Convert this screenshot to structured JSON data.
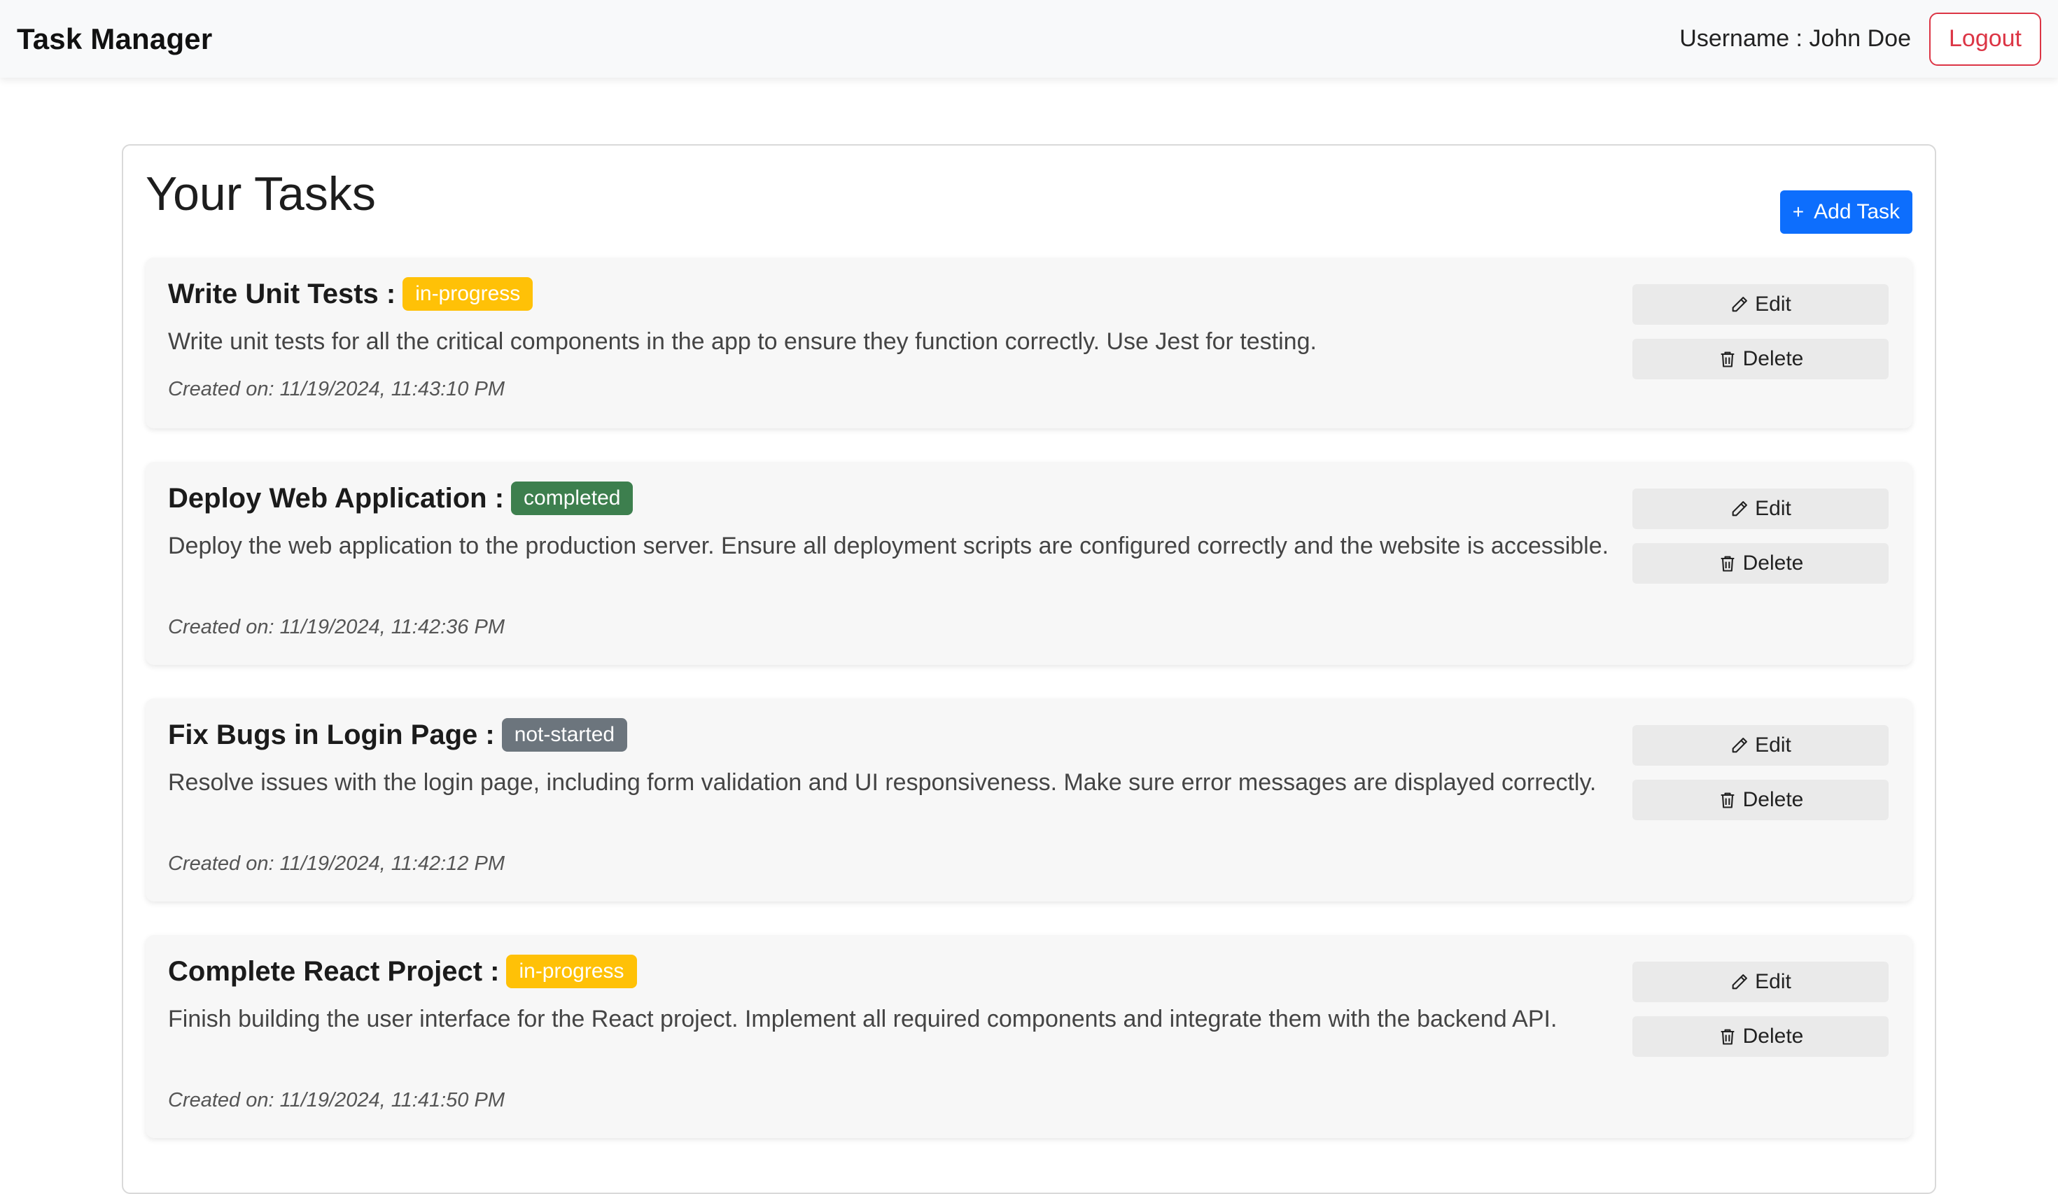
{
  "app": {
    "brand": "Task Manager",
    "username_text": "Username : John Doe",
    "logout_label": "Logout"
  },
  "panel": {
    "title": "Your Tasks",
    "add_label": "Add Task"
  },
  "tasks": [
    {
      "title": "Write Unit Tests :",
      "status": "in-progress",
      "description": "Write unit tests for all the critical components in the app to ensure they function correctly. Use Jest for testing.",
      "created": "Created on: 11/19/2024, 11:43:10 PM",
      "edit_label": "Edit",
      "delete_label": "Delete"
    },
    {
      "title": "Deploy Web Application :",
      "status": "completed",
      "description": "Deploy the web application to the production server. Ensure all deployment scripts are configured correctly and the website is accessible.",
      "created": "Created on: 11/19/2024, 11:42:36 PM",
      "edit_label": "Edit",
      "delete_label": "Delete"
    },
    {
      "title": "Fix Bugs in Login Page :",
      "status": "not-started",
      "description": "Resolve issues with the login page, including form validation and UI responsiveness. Make sure error messages are displayed correctly.",
      "created": "Created on: 11/19/2024, 11:42:12 PM",
      "edit_label": "Edit",
      "delete_label": "Delete"
    },
    {
      "title": "Complete React Project :",
      "status": "in-progress",
      "description": "Finish building the user interface for the React project. Implement all required components and integrate them with the backend API.",
      "created": "Created on: 11/19/2024, 11:41:50 PM",
      "edit_label": "Edit",
      "delete_label": "Delete"
    }
  ],
  "colors": {
    "primary": "#0d6efd",
    "danger": "#dc3545",
    "in_progress": "#ffc107",
    "completed": "#3d7f4e",
    "not_started": "#6c757d"
  }
}
